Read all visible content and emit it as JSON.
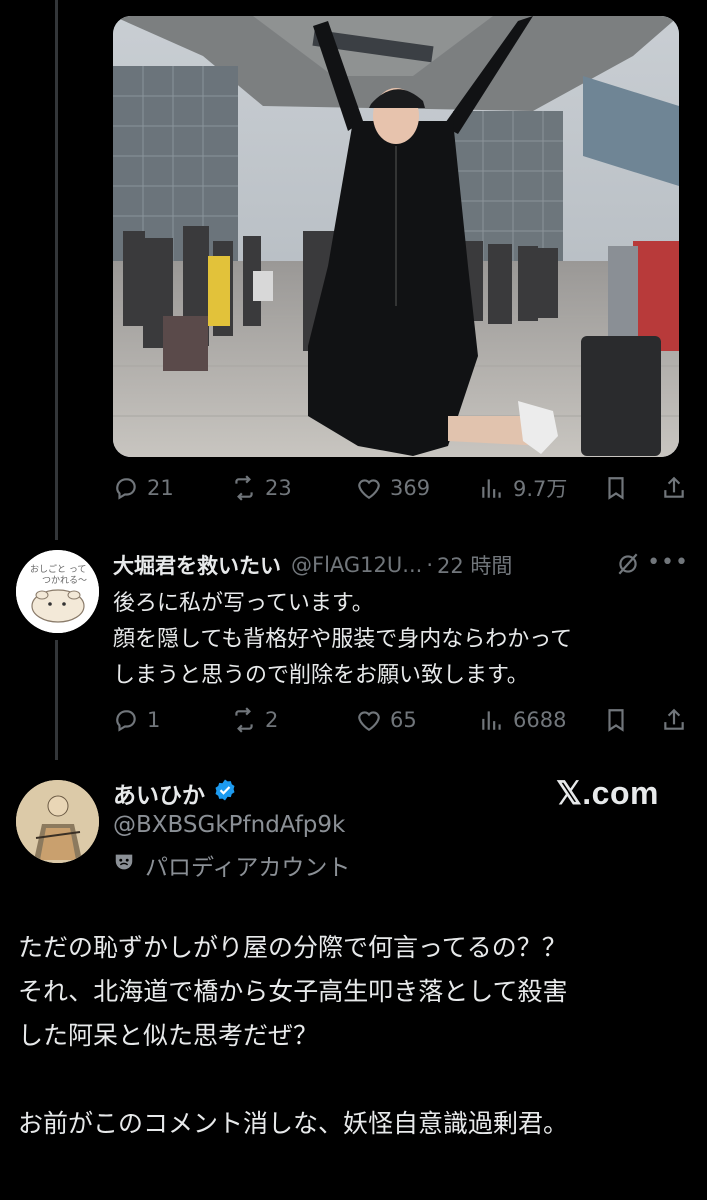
{
  "tweet": {
    "photo": {
      "description_icon": "photo"
    },
    "metrics": {
      "replies": "21",
      "reposts": "23",
      "likes": "369",
      "views": "9.7万"
    }
  },
  "reply": {
    "display_name": "大堀君を救いたい",
    "handle": "@FlAG12U...",
    "dot": "·",
    "time": "22 時間",
    "text_lines": [
      "後ろに私が写っています。",
      "顔を隠しても背格好や服装で身内ならわかって",
      "しまうと思うので削除をお願い致します。"
    ],
    "metrics": {
      "replies": "1",
      "reposts": "2",
      "likes": "65",
      "views": "6688"
    }
  },
  "quote": {
    "display_name": "あいひか",
    "handle": "@BXBSGkPfndAfp9k",
    "label": "パロディアカウント",
    "watermark": "𝕏.com",
    "text_lines": [
      "ただの恥ずかしがり屋の分際で何言ってるの？？",
      "それ、北海道で橋から女子高生叩き落として殺害",
      "した阿呆と似た思考だぜ？",
      "",
      "お前がこのコメント消しな、妖怪自意識過剰君。"
    ]
  },
  "colors": {
    "background": "#000000",
    "text": "#e7e9ea",
    "muted": "#71767b",
    "verified": "#1d9bf0",
    "thread_line": "#333639"
  }
}
